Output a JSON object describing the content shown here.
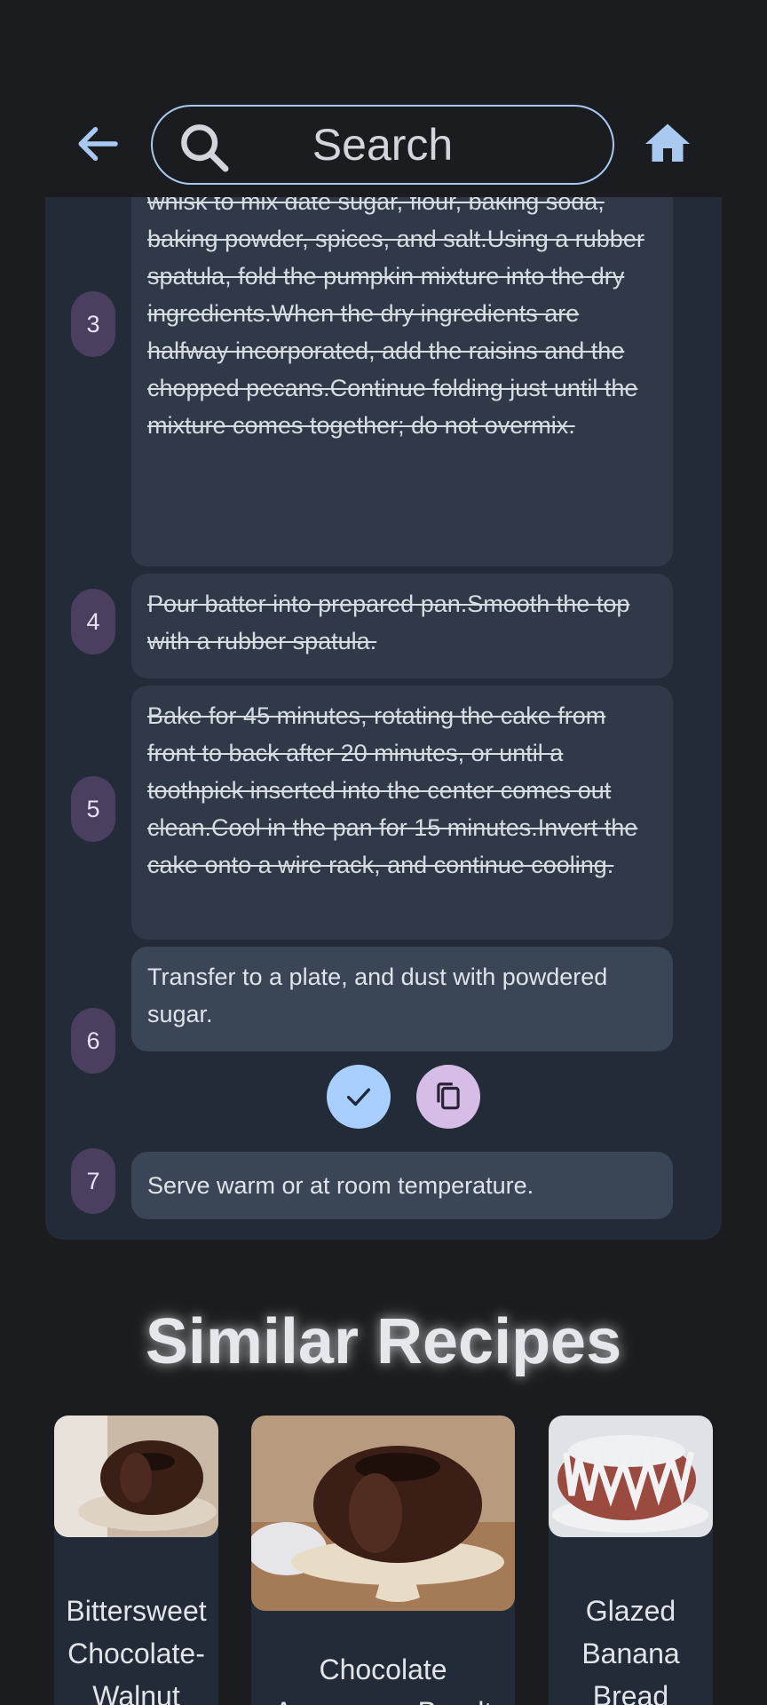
{
  "header": {
    "search_placeholder": "Search",
    "back_icon": "arrow-left-icon",
    "search_icon": "search-icon",
    "home_icon": "home-icon"
  },
  "steps": [
    {
      "number": "3",
      "text": "vinegar, and vanilla.In a large bowl, use a clean whisk to mix date sugar, flour, baking soda, baking powder, spices, and salt.Using a rubber spatula, fold the pumpkin mixture into the dry ingredients.When the dry ingredients are halfway incorporated, add the raisins and the chopped pecans.Continue folding just until the mixture comes together; do not overmix.",
      "done": true
    },
    {
      "number": "4",
      "text": "Pour batter into prepared pan.Smooth the top with a rubber spatula.",
      "done": true
    },
    {
      "number": "5",
      "text": "Bake for 45 minutes, rotating the cake from front to back after 20 minutes, or until a toothpick inserted into the center comes out clean.Cool in the pan for 15 minutes.Invert the cake onto a wire rack, and continue cooling.",
      "done": true
    },
    {
      "number": "6",
      "text": "Transfer to a plate, and dust with powdered sugar.",
      "done": false
    },
    {
      "number": "7",
      "text": "Serve warm or at room temperature.",
      "done": false
    }
  ],
  "step_actions": {
    "check_icon": "check-icon",
    "copy_icon": "copy-icon",
    "check_color": "#a8cfff",
    "copy_color": "#d6bde6"
  },
  "similar": {
    "title": "Similar Recipes",
    "recipes": [
      {
        "name": "Bittersweet Chocolate-Walnut"
      },
      {
        "name": "Chocolate Asparagus Bundt"
      },
      {
        "name": "Glazed Banana Bread"
      }
    ]
  },
  "colors": {
    "background": "#1a1c20",
    "card": "#222b37",
    "step_number_bg": "#4a3f5f",
    "accent_outline": "#a9c9f0"
  }
}
